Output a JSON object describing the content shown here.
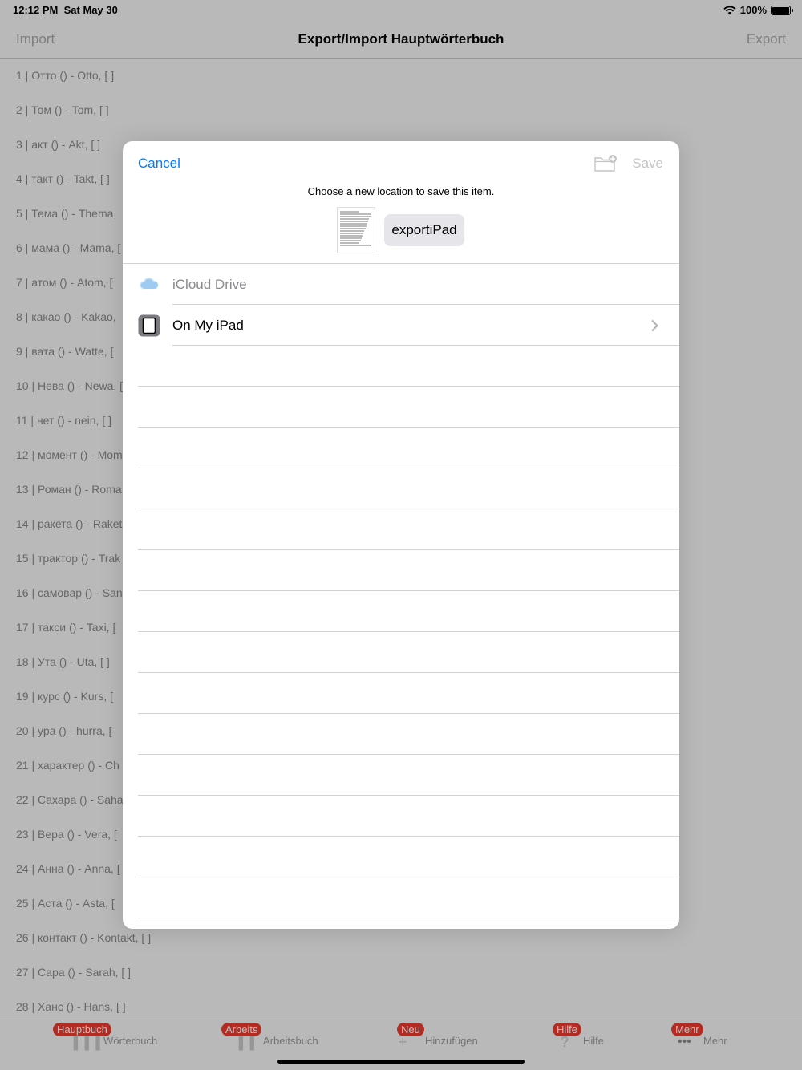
{
  "status_bar": {
    "time": "12:12 PM",
    "date": "Sat May 30",
    "battery": "100%",
    "battery_level": 1.0,
    "wifi_icon": "wifi-icon"
  },
  "nav": {
    "left": "Import",
    "title": "Export/Import Hauptwörterbuch",
    "right": "Export"
  },
  "word_list": [
    "1 | Отто () - Otto, [  ]",
    "2 | Том () - Tom, [  ]",
    "3 | акт () - Akt, [  ]",
    "4 | такт () - Takt, [  ]",
    "5 | Тема () - Thema,",
    "6 | мама () - Mama, [",
    "7 | атом () - Atom, [",
    "8 | какао () - Kakao,",
    "9 | вата () - Watte, [",
    "10 | Нева () - Newa, [",
    "11 | нет () - nein, [  ]",
    "12 | момент () - Mom",
    "13 | Роман () - Roma",
    "14 | ракета () - Raket",
    "15 | трактор () - Trak",
    "16 | самовар () - San",
    "17 | такси () - Taxi, [",
    "18 | Ута () - Uta, [  ]",
    "19 | курс () - Kurs, [",
    "20 | ура () - hurra, [",
    "21 | характер () - Ch",
    "22 | Сахара () - Saha",
    "23 | Вера () - Vera, [",
    "24 | Анна () - Anna, [",
    "25 | Аста () - Asta, [",
    "26 | контакт () - Kontakt, [  ]",
    "27 | Сара () - Sarah, [  ]",
    "28 | Ханс () - Hans, [  ]"
  ],
  "tabs": [
    {
      "badge": "Hauptbuch",
      "label": "Wörterbuch",
      "icon": "books-icon"
    },
    {
      "badge": "Arbeits",
      "label": "Arbeitsbuch",
      "icon": "book-icon"
    },
    {
      "badge": "Neu",
      "label": "Hinzufügen",
      "icon": "plus-icon"
    },
    {
      "badge": "Hilfe",
      "label": "Hilfe",
      "icon": "question-icon"
    },
    {
      "badge": "Mehr",
      "label": "Mehr",
      "icon": "more-icon"
    }
  ],
  "modal": {
    "cancel": "Cancel",
    "save": "Save",
    "new_folder_icon": "new-folder-icon",
    "prompt": "Choose a new location to save this item.",
    "filename": "exportiPad",
    "locations": [
      {
        "label": "iCloud Drive",
        "icon": "icloud-icon",
        "enabled": false
      },
      {
        "label": "On My iPad",
        "icon": "ipad-icon",
        "enabled": true
      }
    ]
  },
  "colors": {
    "accent": "#007aff",
    "badge": "#ee3b30",
    "disabled": "#c4c4c6"
  }
}
